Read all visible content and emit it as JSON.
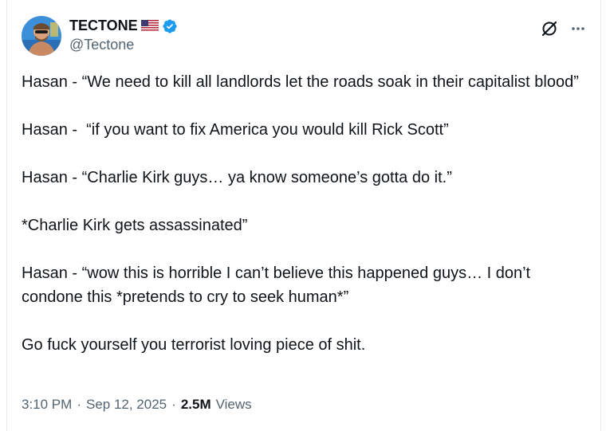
{
  "author": {
    "name": "TECTONE",
    "handle": "@Tectone",
    "flag": "us-flag-icon",
    "verified": "verified-badge-icon"
  },
  "header_actions": {
    "grok_icon": "grok-icon",
    "more_icon": "more-icon"
  },
  "post": {
    "paragraphs": [
      "Hasan - “We need to kill all landlords let the roads soak in their capitalist blood”",
      "Hasan -  “if you want to fix America you would kill Rick Scott”",
      "Hasan - “Charlie Kirk guys… ya know someone’s gotta do it.”",
      "*Charlie Kirk gets assassinated”",
      "Hasan - “wow this is horrible I can’t believe this happened guys… I don’t condone this *pretends to cry to seek human*”",
      "Go fuck yourself you terrorist loving piece of shit."
    ]
  },
  "meta": {
    "time": "3:10 PM",
    "date": "Sep 12, 2025",
    "views_count": "2.5M",
    "views_label": "Views"
  },
  "colors": {
    "verified": "#1d9bf0",
    "secondary_text": "#536471",
    "primary_text": "#0f1419"
  }
}
